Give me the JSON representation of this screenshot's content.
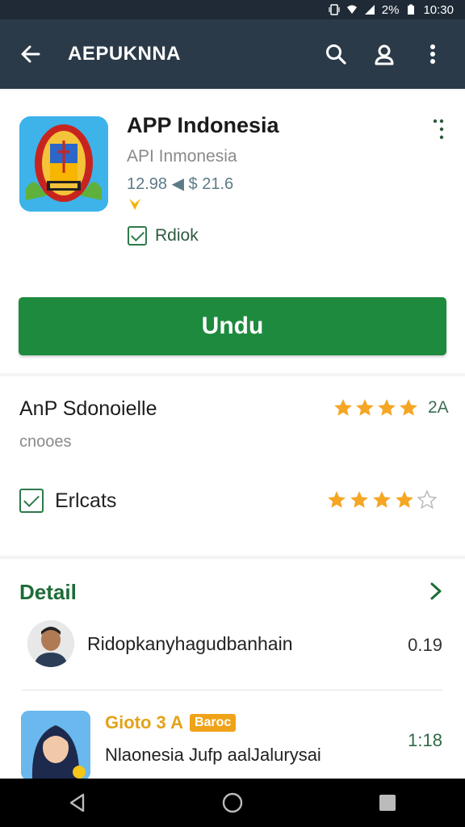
{
  "status_bar": {
    "battery": "2%",
    "time": "10:30"
  },
  "app_bar": {
    "title": "AEPUKNNA"
  },
  "app": {
    "name": "APP Indonesia",
    "developer": "API Inmonesia",
    "meta": "12.98 ◀ $ 21.6",
    "check_label": "Rdiok",
    "install_label": "Undu"
  },
  "rating": {
    "title": "AnP Sdonoielle",
    "subtitle": "cnooes",
    "top_stars": 4,
    "top_count": "2A",
    "check_label": "Erlcats",
    "bottom_stars": 4,
    "bottom_max": 5
  },
  "detail": {
    "title": "Detail",
    "rows": [
      {
        "name": "Ridopkanyhagudbanhain",
        "value": "0.19"
      },
      {
        "line1": "Gioto 3 A",
        "tag": "Baroc",
        "line2": "Nlaonesia Jufp aalJalurysai",
        "value": "1:18"
      }
    ]
  },
  "colors": {
    "accent": "#1e8a3e",
    "app_bar": "#2b3a48",
    "star": "#f5a623"
  }
}
